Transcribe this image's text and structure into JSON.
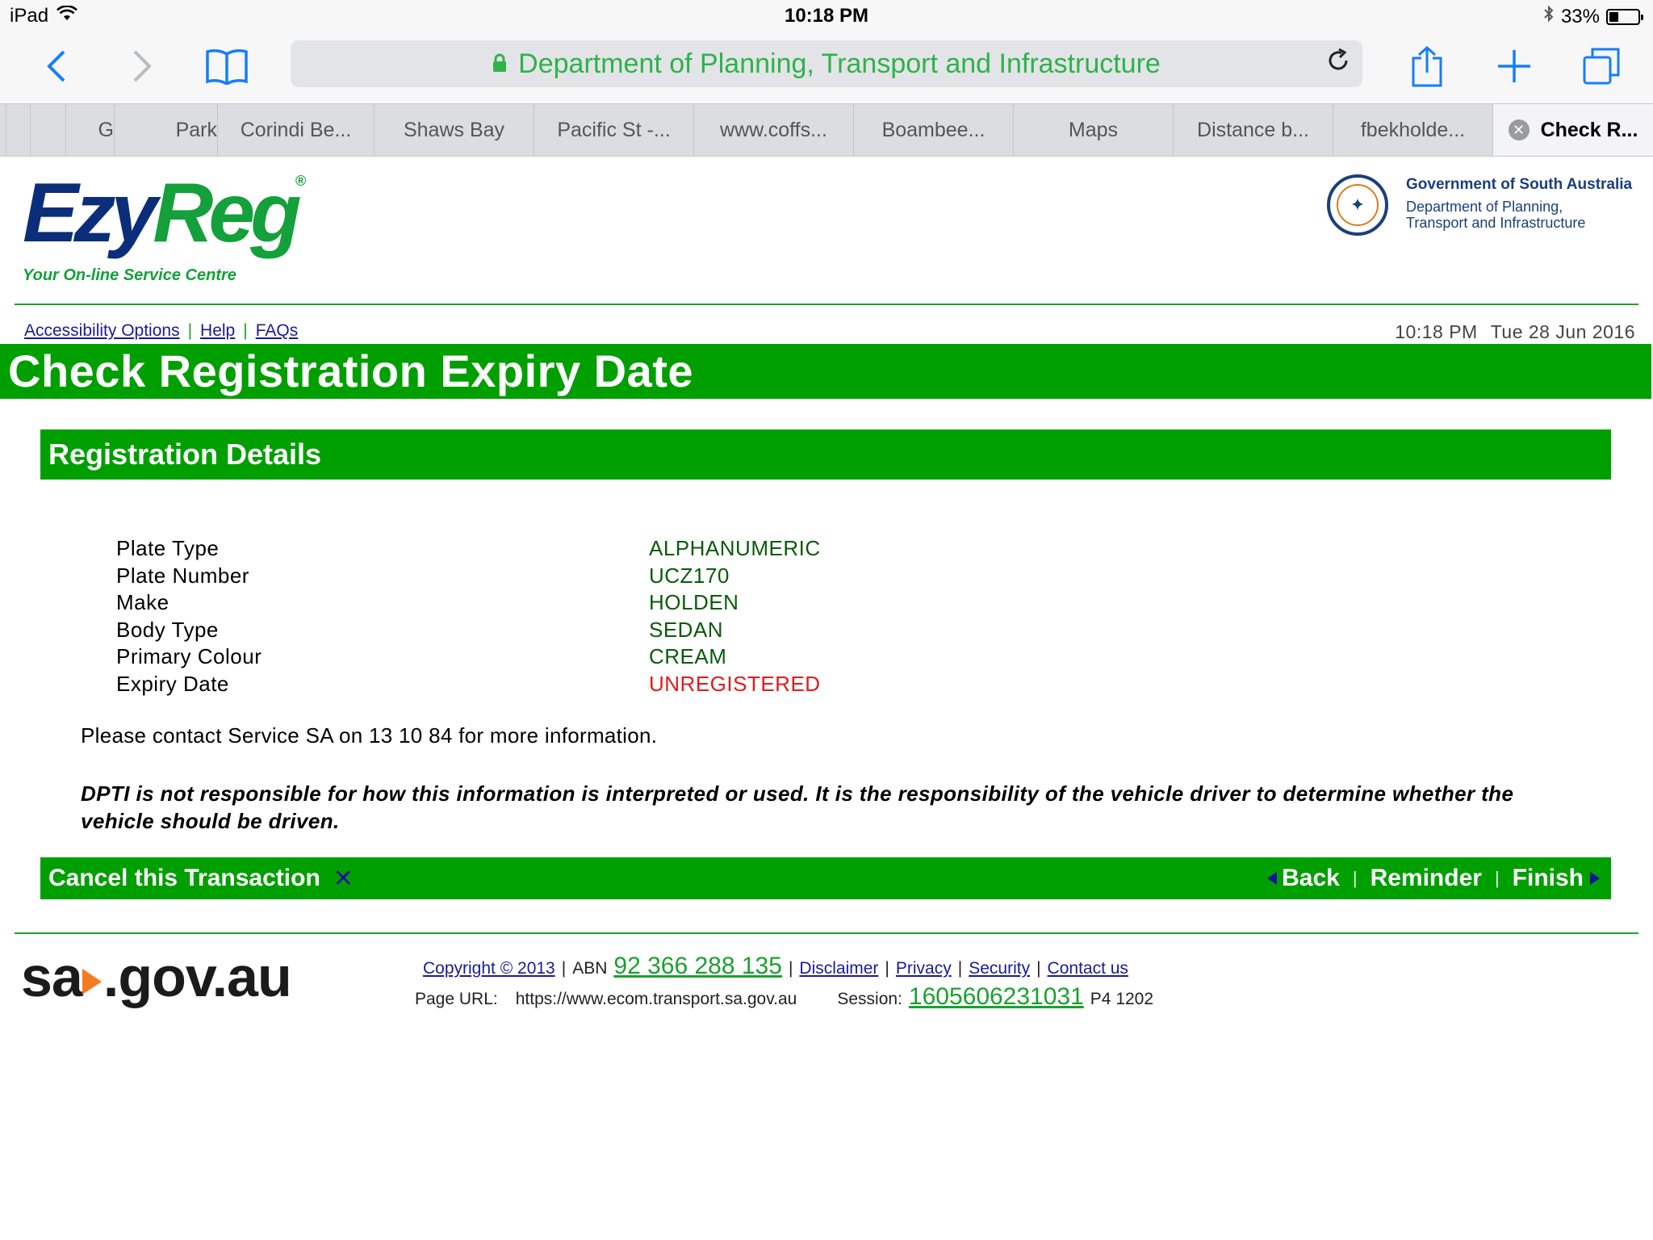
{
  "status_bar": {
    "device": "iPad",
    "time": "10:18 PM",
    "battery": "33%",
    "battery_level": 0.33
  },
  "browser": {
    "url_title": "Department of Planning, Transport and Infrastructure",
    "tabs": [
      {
        "label": "G"
      },
      {
        "label": "Park"
      },
      {
        "label": "Corindi Be..."
      },
      {
        "label": "Shaws Bay"
      },
      {
        "label": "Pacific St -..."
      },
      {
        "label": "www.coffs..."
      },
      {
        "label": "Boambee..."
      },
      {
        "label": "Maps"
      },
      {
        "label": "Distance b..."
      },
      {
        "label": "fbekholde..."
      },
      {
        "label": "Check R..."
      }
    ]
  },
  "header": {
    "logo_word1": "Ezy",
    "logo_word2": "Reg",
    "logo_mark": "®",
    "tagline": "Your On-line Service Centre",
    "gov_title": "Government of South Australia",
    "gov_subtitle": "Department of Planning, Transport and Infrastructure"
  },
  "top_links": [
    "Accessibility Options",
    "Help",
    "FAQs"
  ],
  "datetime": {
    "time": "10:18 PM",
    "date": "Tue 28 Jun 2016"
  },
  "page_title": "Check Registration Expiry Date",
  "section_title": "Registration Details",
  "details": [
    {
      "label": "Plate Type",
      "value": "ALPHANUMERIC"
    },
    {
      "label": "Plate Number",
      "value": "UCZ170"
    },
    {
      "label": "Make",
      "value": "HOLDEN"
    },
    {
      "label": "Body Type",
      "value": "SEDAN"
    },
    {
      "label": "Primary Colour",
      "value": "CREAM"
    },
    {
      "label": "Expiry Date",
      "value": "UNREGISTERED"
    }
  ],
  "contact_note": "Please contact Service SA on 13 10 84 for more information.",
  "disclaimer": "DPTI is not responsible for how this information is interpreted or used. It is the responsibility of the vehicle driver to determine whether the vehicle should be driven.",
  "actions": {
    "cancel": "Cancel this Transaction",
    "back": "Back",
    "reminder": "Reminder",
    "finish": "Finish"
  },
  "footer": {
    "sa_logo_left": "sa",
    "sa_logo_right": ".gov.au",
    "copyright": "Copyright © 2013",
    "abn_label": "ABN",
    "abn": "92 366 288 135",
    "links": [
      "Disclaimer",
      "Privacy",
      "Security",
      "Contact us"
    ],
    "page_url_label": "Page URL:",
    "page_url": "https://www.ecom.transport.sa.gov.au",
    "session_label": "Session:",
    "session": "1605606231031",
    "page_code": "P4 1202"
  },
  "colors": {
    "green": "#009f00",
    "alert": "#e01b1b",
    "link": "#1a1a99",
    "safari_blue": "#147efb"
  }
}
